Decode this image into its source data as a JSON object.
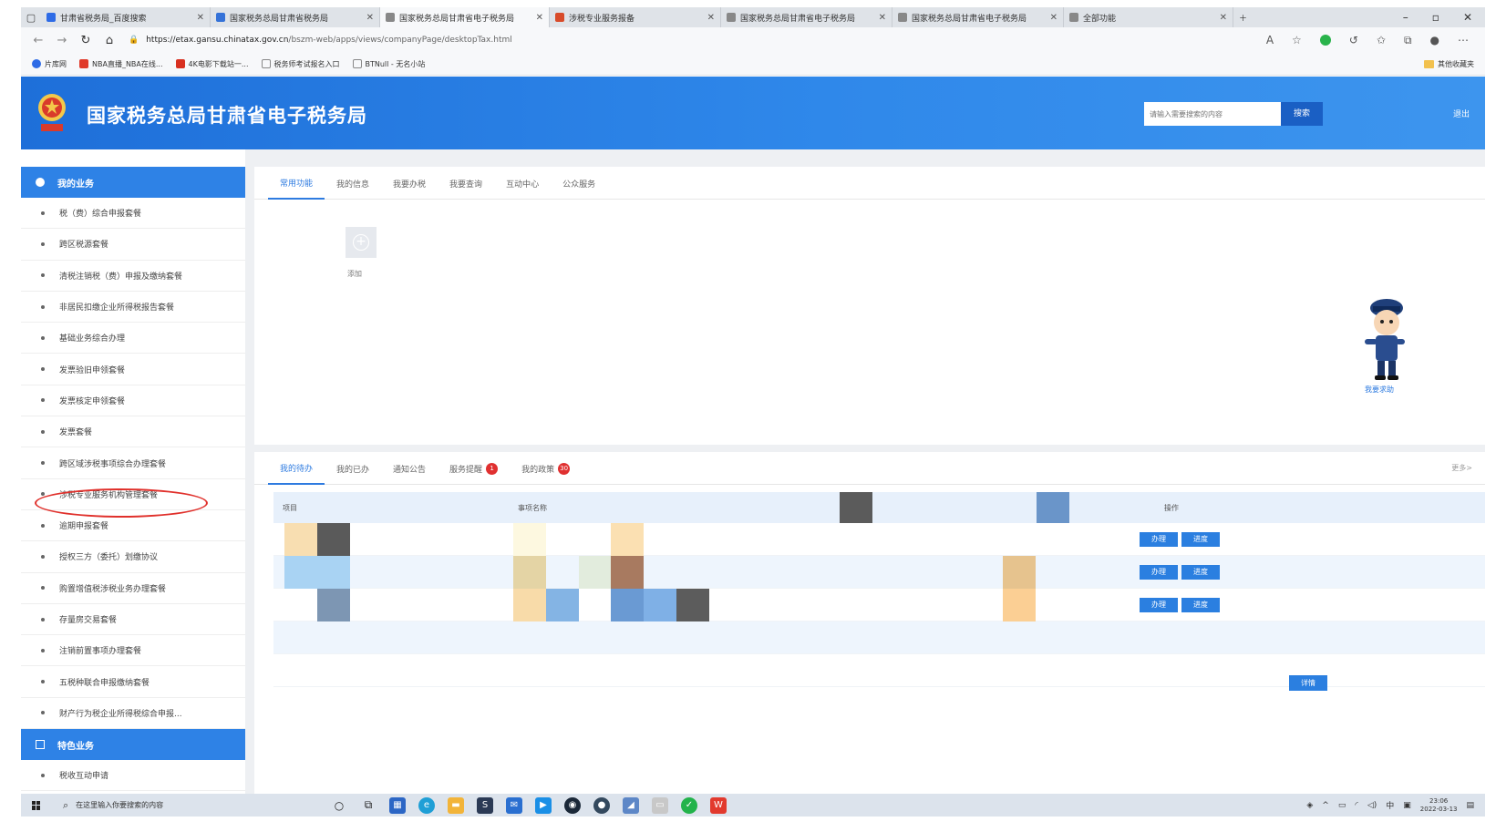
{
  "browser": {
    "tabs": [
      {
        "label": "甘肃省税务局_百度搜索",
        "active": false,
        "color": "#2e6be6"
      },
      {
        "label": "国家税务总局甘肃省税务局",
        "active": false,
        "color": "#3572d8"
      },
      {
        "label": "国家税务总局甘肃省电子税务局",
        "active": true,
        "color": "#888888"
      },
      {
        "label": "涉税专业服务报备",
        "active": false,
        "color": "#d84b2a"
      },
      {
        "label": "国家税务总局甘肃省电子税务局",
        "active": false,
        "color": "#888888"
      },
      {
        "label": "国家税务总局甘肃省电子税务局",
        "active": false,
        "color": "#888888"
      },
      {
        "label": "全部功能",
        "active": false,
        "color": "#888888"
      }
    ],
    "url_host": "https://etax.gansu.chinatax.gov.cn",
    "url_path": "/bszm-web/apps/views/companyPage/desktopTax.html",
    "bookmarks": [
      {
        "label": "片库网",
        "color": "#2e6be6"
      },
      {
        "label": "NBA直播_NBA在线...",
        "color": "#e03a2a"
      },
      {
        "label": "4K电影下载站一...",
        "color": "#d83020"
      },
      {
        "label": "税务师考试报名入口",
        "color": "#888888"
      },
      {
        "label": "BTNull - 无名小站",
        "color": "#888888"
      }
    ],
    "other_bookmarks": "其他收藏夹"
  },
  "header": {
    "site_title": "国家税务总局甘肃省电子税务局",
    "search_placeholder": "请输入需要搜索的内容",
    "search_button": "搜索",
    "logout": "退出"
  },
  "sidebar": {
    "section1": "我的业务",
    "items": [
      "税（费）综合申报套餐",
      "跨区税源套餐",
      "清税注销税（费）申报及缴纳套餐",
      "非居民扣缴企业所得税报告套餐",
      "基础业务综合办理",
      "发票验旧申领套餐",
      "发票核定申领套餐",
      "发票套餐",
      "跨区域涉税事项综合办理套餐",
      "涉税专业服务机构管理套餐",
      "逾期申报套餐",
      "授权三方（委托）划缴协议",
      "购置增值税涉税业务办理套餐",
      "存量房交易套餐",
      "注销前置事项办理套餐",
      "五税种联合申报缴纳套餐",
      "财产行为税企业所得税综合申报..."
    ],
    "section2": "特色业务",
    "items2": [
      "税收互动申请"
    ]
  },
  "panel1": {
    "tabs": [
      "常用功能",
      "我的信息",
      "我要办税",
      "我要查询",
      "互动中心",
      "公众服务"
    ],
    "add_label": "添加"
  },
  "panel2": {
    "tabs": [
      "我的待办",
      "我的已办",
      "通知公告",
      "服务提醒",
      "我的政策"
    ],
    "badges": {
      "服务提醒": "1",
      "我的政策": "30"
    },
    "more": "更多>",
    "columns": [
      "项目",
      "事项名称",
      "操作"
    ],
    "row_actions": [
      "办理",
      "进度"
    ],
    "detail_button": "详情"
  },
  "mascot_label": "我要求助",
  "taskbar": {
    "search_placeholder": "在这里输入你要搜索的内容",
    "time": "23:06",
    "date": "2022-03-13",
    "ime": "中"
  }
}
